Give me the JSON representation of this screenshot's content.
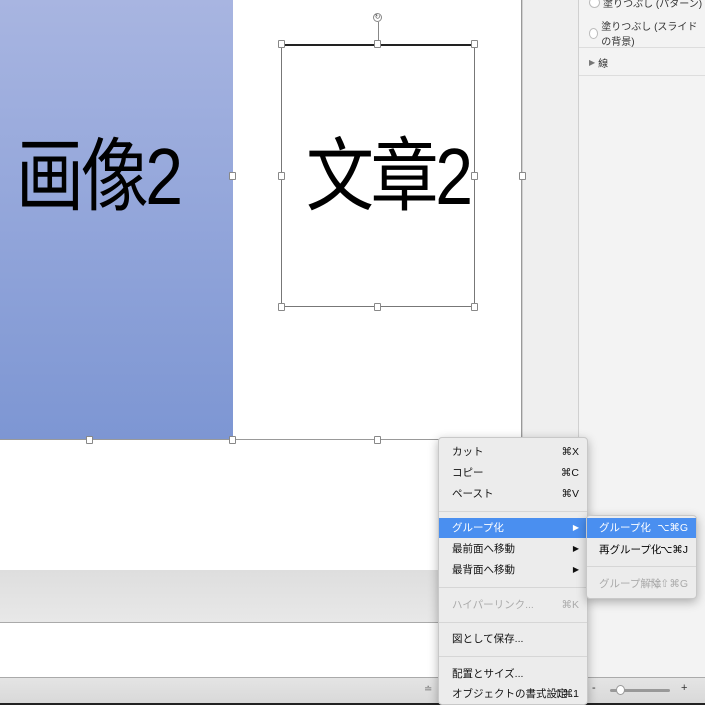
{
  "slide": {
    "image_text": "画像2",
    "text_box_text": "文章2",
    "image_color": "#8fa3d9"
  },
  "format_panel": {
    "fill_options": [
      "塗りつぶし (パターン)",
      "塗りつぶし (スライドの背景)"
    ],
    "line_section": "線",
    "expand_icon": "triangle-right"
  },
  "context_menu": {
    "items": [
      {
        "label": "カット",
        "shortcut": "⌘X"
      },
      {
        "label": "コピー",
        "shortcut": "⌘C"
      },
      {
        "label": "ペースト",
        "shortcut": "⌘V"
      },
      {
        "label": "グループ化",
        "shortcut": "▶"
      },
      {
        "label": "最前面へ移動",
        "shortcut": "▶"
      },
      {
        "label": "最背面へ移動",
        "shortcut": "▶"
      },
      {
        "label": "ハイパーリンク...",
        "shortcut": "⌘K"
      },
      {
        "label": "図として保存..."
      },
      {
        "label": "配置とサイズ..."
      },
      {
        "label": "オブジェクトの書式設定...",
        "shortcut": "⇧⌘1"
      }
    ],
    "submenu": [
      {
        "label": "グループ化",
        "shortcut": "⌥⌘G"
      },
      {
        "label": "再グループ化",
        "shortcut": "⌥⌘J"
      },
      {
        "label": "グループ解除",
        "shortcut": "⌥⇧⌘G"
      }
    ],
    "highlight_color": "#4a8ff0"
  },
  "status_bar": {
    "zoom_minus": "-",
    "zoom_plus": "+",
    "zoom_level": 0.3
  }
}
